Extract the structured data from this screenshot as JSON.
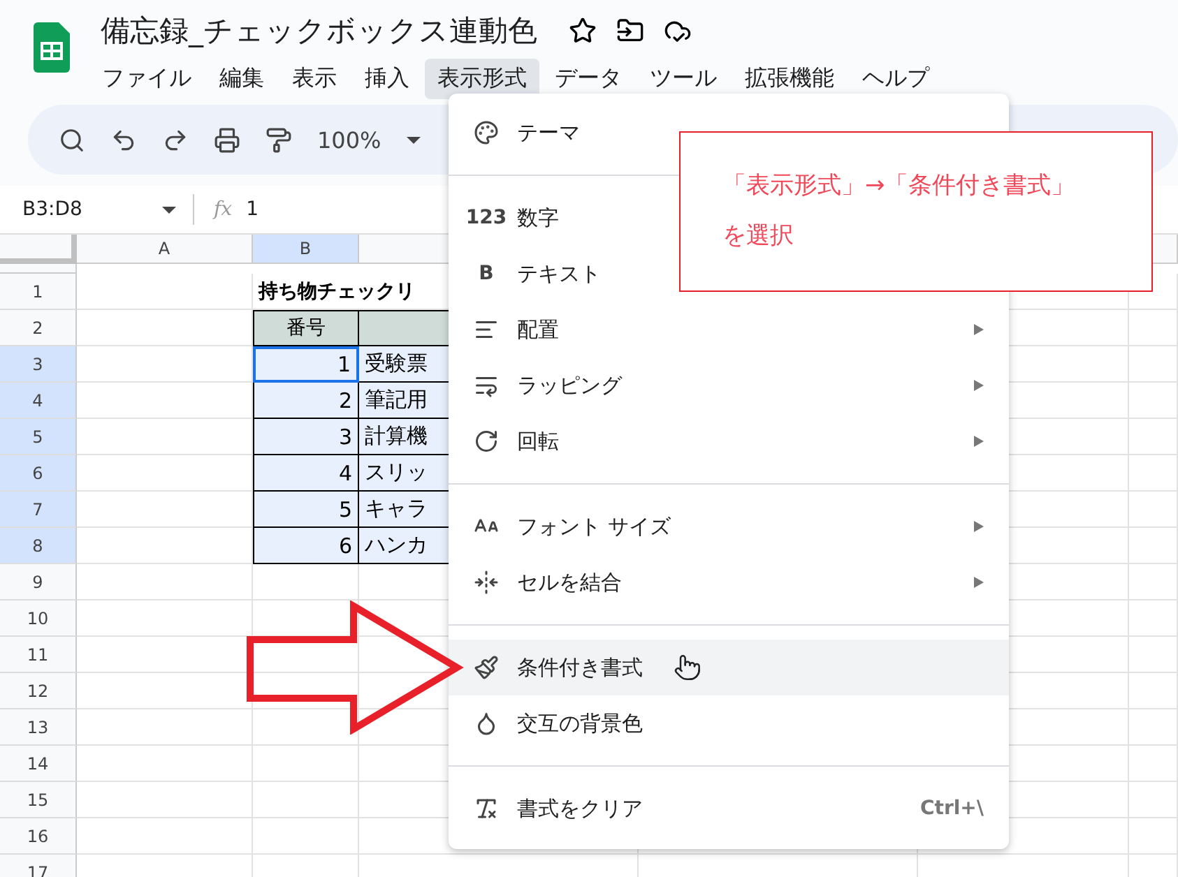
{
  "document": {
    "title": "備忘録_チェックボックス連動色"
  },
  "menubar": [
    {
      "label": "ファイル",
      "selected": false
    },
    {
      "label": "編集",
      "selected": false
    },
    {
      "label": "表示",
      "selected": false
    },
    {
      "label": "挿入",
      "selected": false
    },
    {
      "label": "表示形式",
      "selected": true
    },
    {
      "label": "データ",
      "selected": false
    },
    {
      "label": "ツール",
      "selected": false
    },
    {
      "label": "拡張機能",
      "selected": false
    },
    {
      "label": "ヘルプ",
      "selected": false
    }
  ],
  "toolbar": {
    "zoom": "100%"
  },
  "formula_bar": {
    "name_box": "B3:D8",
    "fx": "fx",
    "value": "1"
  },
  "columns": [
    {
      "label": "A",
      "selected": false
    },
    {
      "label": "B",
      "selected": true
    }
  ],
  "rows": [
    {
      "number": "1",
      "selected": false,
      "kind": "title",
      "b": "持ち物チェックリ"
    },
    {
      "number": "2",
      "selected": false,
      "kind": "header",
      "b": "番号"
    },
    {
      "number": "3",
      "selected": true,
      "kind": "data",
      "b": "1",
      "c": "受験票",
      "active": true
    },
    {
      "number": "4",
      "selected": true,
      "kind": "data",
      "b": "2",
      "c": "筆記用",
      "active": false
    },
    {
      "number": "5",
      "selected": true,
      "kind": "data",
      "b": "3",
      "c": "計算機",
      "active": false
    },
    {
      "number": "6",
      "selected": true,
      "kind": "data",
      "b": "4",
      "c": "スリッ",
      "active": false
    },
    {
      "number": "7",
      "selected": true,
      "kind": "data",
      "b": "5",
      "c": "キャラ",
      "active": false
    },
    {
      "number": "8",
      "selected": true,
      "kind": "data",
      "b": "6",
      "c": "ハンカ",
      "active": false
    },
    {
      "number": "9",
      "selected": false,
      "kind": "empty"
    },
    {
      "number": "10",
      "selected": false,
      "kind": "empty"
    },
    {
      "number": "11",
      "selected": false,
      "kind": "empty"
    },
    {
      "number": "12",
      "selected": false,
      "kind": "empty"
    },
    {
      "number": "13",
      "selected": false,
      "kind": "empty"
    },
    {
      "number": "14",
      "selected": false,
      "kind": "empty"
    },
    {
      "number": "15",
      "selected": false,
      "kind": "empty"
    },
    {
      "number": "16",
      "selected": false,
      "kind": "empty"
    },
    {
      "number": "17",
      "selected": false,
      "kind": "empty"
    }
  ],
  "format_menu": {
    "items": [
      {
        "kind": "item",
        "label": "テーマ",
        "submenu": false,
        "selected": false
      },
      {
        "kind": "divider"
      },
      {
        "kind": "item",
        "glyph": "123",
        "label": "数字",
        "submenu": false,
        "selected": false
      },
      {
        "kind": "item",
        "glyph": "B",
        "label": "テキスト",
        "submenu": false,
        "selected": false
      },
      {
        "kind": "item",
        "label": "配置",
        "submenu": true,
        "selected": false
      },
      {
        "kind": "item",
        "label": "ラッピング",
        "submenu": true,
        "selected": false
      },
      {
        "kind": "item",
        "label": "回転",
        "submenu": true,
        "selected": false
      },
      {
        "kind": "divider"
      },
      {
        "kind": "item",
        "label": "フォント サイズ",
        "submenu": true,
        "selected": false
      },
      {
        "kind": "item",
        "label": "セルを結合",
        "submenu": true,
        "selected": false
      },
      {
        "kind": "divider"
      },
      {
        "kind": "item",
        "label": "条件付き書式",
        "submenu": false,
        "selected": true
      },
      {
        "kind": "item",
        "label": "交互の背景色",
        "submenu": false,
        "selected": false
      },
      {
        "kind": "divider"
      },
      {
        "kind": "item",
        "label": "書式をクリア",
        "submenu": false,
        "selected": false,
        "shortcut": "Ctrl+\\"
      }
    ]
  },
  "callout": {
    "lines": [
      "「表示形式」→「条件付き書式」",
      "を選択"
    ]
  }
}
